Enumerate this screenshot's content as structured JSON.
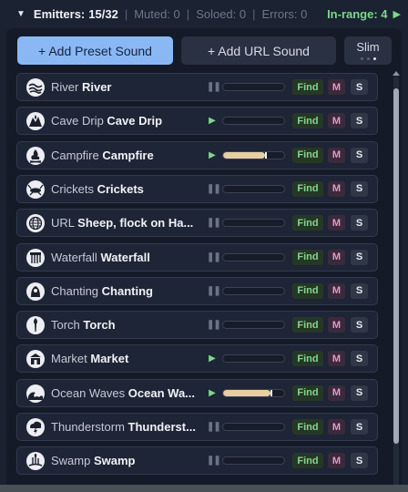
{
  "header": {
    "title": "Emitters:",
    "count": "15/32",
    "muted": "Muted: 0",
    "soloed": "Soloed: 0",
    "errors": "Errors: 0",
    "in_range": "In-range: 4"
  },
  "toolbar": {
    "add_preset": "+ Add Preset Sound",
    "add_url": "+ Add URL Sound",
    "slim": "Slim"
  },
  "emitters": [
    {
      "kind": "River",
      "name": "River",
      "icon": "river-icon",
      "playing": false,
      "level": 0,
      "find": "Find",
      "mute": "M",
      "solo": "S"
    },
    {
      "kind": "Cave Drip",
      "name": "Cave Drip",
      "icon": "cave-drip-icon",
      "playing": true,
      "level": 0,
      "find": "Find",
      "mute": "M",
      "solo": "S"
    },
    {
      "kind": "Campfire",
      "name": "Campfire",
      "icon": "campfire-icon",
      "playing": true,
      "level": 0.68,
      "find": "Find",
      "mute": "M",
      "solo": "S"
    },
    {
      "kind": "Crickets",
      "name": "Crickets",
      "icon": "crickets-icon",
      "playing": false,
      "level": 0,
      "find": "Find",
      "mute": "M",
      "solo": "S"
    },
    {
      "kind": "URL",
      "name": "Sheep, flock on Ha...",
      "icon": "globe-icon",
      "playing": false,
      "level": 0,
      "find": "Find",
      "mute": "M",
      "solo": "S"
    },
    {
      "kind": "Waterfall",
      "name": "Waterfall",
      "icon": "waterfall-icon",
      "playing": false,
      "level": 0,
      "find": "Find",
      "mute": "M",
      "solo": "S"
    },
    {
      "kind": "Chanting",
      "name": "Chanting",
      "icon": "chanting-icon",
      "playing": false,
      "level": 0,
      "find": "Find",
      "mute": "M",
      "solo": "S"
    },
    {
      "kind": "Torch",
      "name": "Torch",
      "icon": "torch-icon",
      "playing": false,
      "level": 0,
      "find": "Find",
      "mute": "M",
      "solo": "S"
    },
    {
      "kind": "Market",
      "name": "Market",
      "icon": "market-icon",
      "playing": true,
      "level": 0,
      "find": "Find",
      "mute": "M",
      "solo": "S"
    },
    {
      "kind": "Ocean Waves",
      "name": "Ocean Wa...",
      "icon": "ocean-waves-icon",
      "playing": true,
      "level": 0.78,
      "find": "Find",
      "mute": "M",
      "solo": "S"
    },
    {
      "kind": "Thunderstorm",
      "name": "Thunderst...",
      "icon": "thunderstorm-icon",
      "playing": false,
      "level": 0,
      "find": "Find",
      "mute": "M",
      "solo": "S"
    },
    {
      "kind": "Swamp",
      "name": "Swamp",
      "icon": "swamp-icon",
      "playing": false,
      "level": 0,
      "find": "Find",
      "mute": "M",
      "solo": "S"
    }
  ],
  "colors": {
    "accent_green": "#7dd88a",
    "preset_button": "#8ab8f5",
    "meter_fill": "#e6cfa0",
    "mute_text": "#e49ac6"
  }
}
